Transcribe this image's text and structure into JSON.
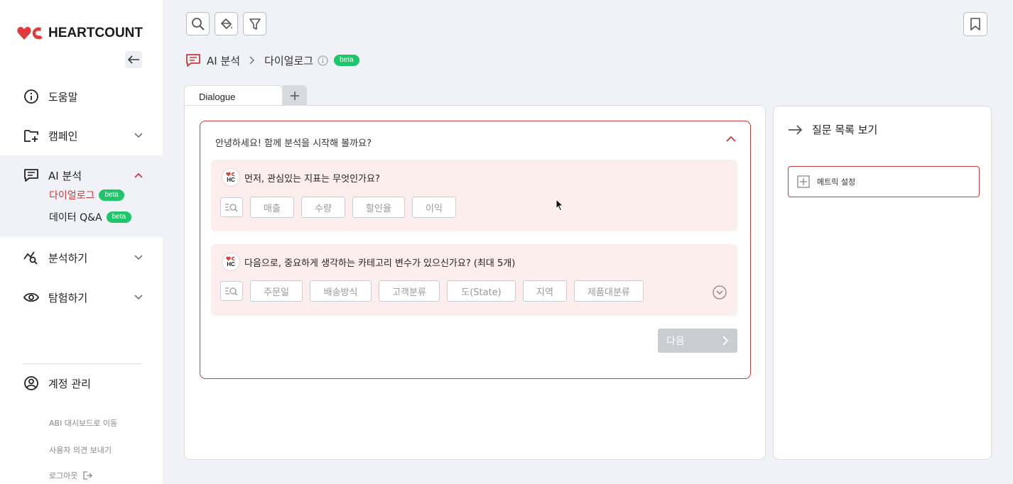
{
  "brand": {
    "name": "HEARTCOUNT",
    "color": "#e03a3a"
  },
  "sidebar": {
    "items": [
      {
        "label": "도움말",
        "icon": "info-icon"
      },
      {
        "label": "캠페인",
        "icon": "folder-plus-icon"
      },
      {
        "label": "AI 분석",
        "icon": "chat-icon",
        "expanded": true
      },
      {
        "label": "분석하기",
        "icon": "analysis-icon"
      },
      {
        "label": "탐험하기",
        "icon": "eye-icon"
      }
    ],
    "sub_items": [
      {
        "label": "다이얼로그",
        "badge": "beta",
        "active": true
      },
      {
        "label": "데이터 Q&A",
        "badge": "beta"
      }
    ],
    "account": {
      "label": "계정 관리",
      "icon": "user-circle-icon"
    },
    "footer_links": [
      {
        "label": "ABI 대시보드로 이동"
      },
      {
        "label": "사용자 의견 보내기"
      },
      {
        "label": "로그아웃",
        "icon": "logout-icon"
      }
    ]
  },
  "toolbar": {
    "buttons": [
      {
        "icon": "search-icon"
      },
      {
        "icon": "paint-bucket-icon"
      },
      {
        "icon": "filter-icon"
      }
    ],
    "bookmark_icon": "bookmark-icon"
  },
  "breadcrumb": {
    "parent": "AI 분석",
    "current": "다이얼로그",
    "badge": "beta"
  },
  "tabs": {
    "items": [
      {
        "label": "Dialogue",
        "active": true
      }
    ],
    "add_label": "+"
  },
  "dialog": {
    "title": "안녕하세요! 함께 분석을 시작해 볼까요?",
    "questions": [
      {
        "avatar_text": "HC",
        "text": "먼저, 관심있는 지표는 무엇인가요?",
        "options": [
          "매출",
          "수량",
          "할인율",
          "이익"
        ]
      },
      {
        "avatar_text": "HC",
        "text": "다음으로, 중요하게 생각하는 카테고리 변수가 있으신가요? (최대 5개)",
        "options": [
          "주문일",
          "배송방식",
          "고객분류",
          "도(State)",
          "지역",
          "제품대분류"
        ]
      }
    ],
    "next_label": "다음"
  },
  "right_panel": {
    "title": "질문 목록 보기",
    "metric_label": "메트릭 설정"
  },
  "colors": {
    "accent_red": "#c43c3c",
    "beta_green": "#1ec66a",
    "question_bg": "#fdeeee",
    "page_bg": "#f0f2f7"
  }
}
